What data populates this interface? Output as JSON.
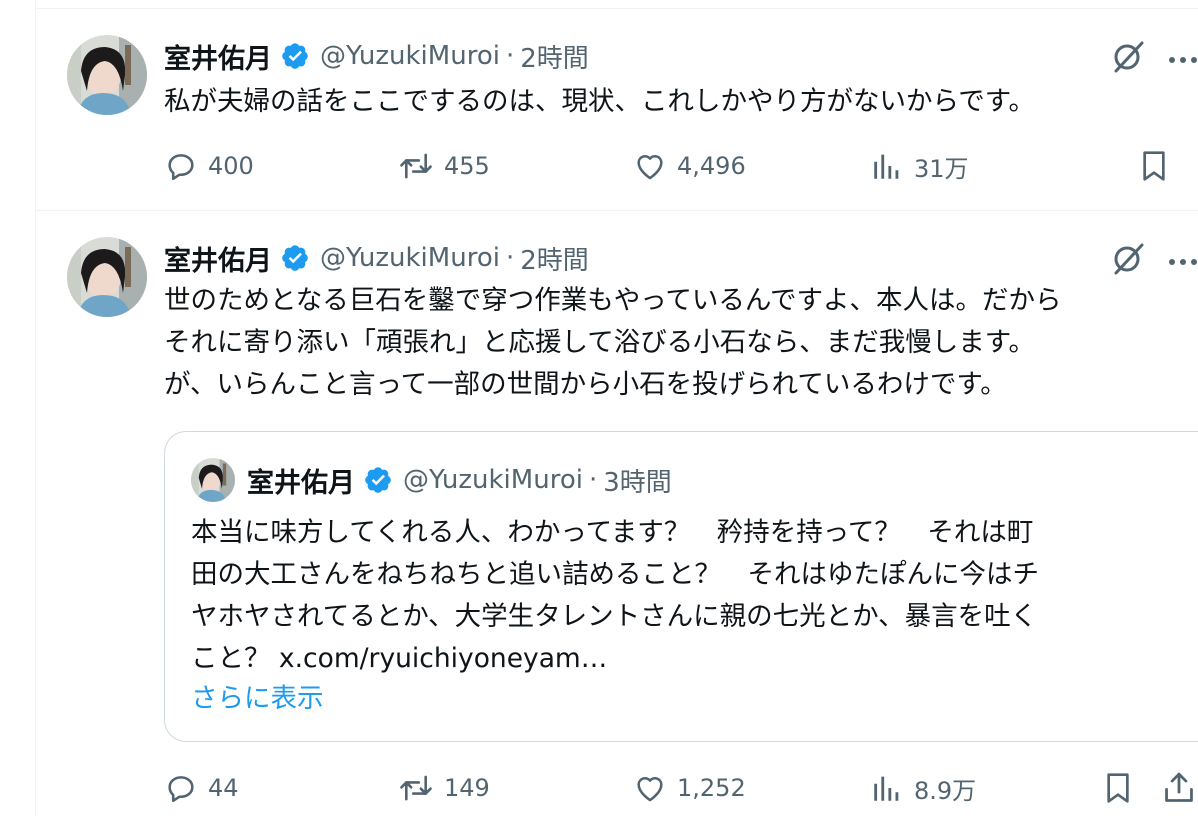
{
  "tweets": [
    {
      "author": {
        "name": "室井佑月",
        "handle": "@YuzukiMuroi",
        "verified": true
      },
      "separator": "·",
      "time": "2時間",
      "text_lines": [
        "私が夫婦の話をここでするのは、現状、これしかやり方がないからです。"
      ],
      "stats": {
        "replies": "400",
        "retweets": "455",
        "likes": "4,496",
        "views": "31万"
      }
    },
    {
      "author": {
        "name": "室井佑月",
        "handle": "@YuzukiMuroi",
        "verified": true
      },
      "separator": "·",
      "time": "2時間",
      "text_lines": [
        "世のためとなる巨石を鑿で穿つ作業もやっているんですよ、本人は。だから",
        "それに寄り添い「頑張れ」と応援して浴びる小石なら、まだ我慢します。",
        "が、いらんこと言って一部の世間から小石を投げられているわけです。"
      ],
      "quote": {
        "author": {
          "name": "室井佑月",
          "handle": "@YuzukiMuroi",
          "verified": true
        },
        "separator": "·",
        "time": "3時間",
        "text_lines": [
          "本当に味方してくれる人、わかってます？　矜持を持って？　それは町",
          "田の大工さんをねちねちと追い詰めること？　それはゆたぽんに今はチ",
          "ヤホヤされてるとか、大学生タレントさんに親の七光とか、暴言を吐く",
          "こと？ x.com/ryuichiyoneyam…"
        ],
        "show_more": "さらに表示"
      },
      "stats": {
        "replies": "44",
        "retweets": "149",
        "likes": "1,252",
        "views": "8.9万"
      }
    }
  ],
  "icons": {
    "reply": "speech-bubble-icon",
    "retweet": "retweet-arrows-icon",
    "like": "heart-icon",
    "views": "bar-chart-icon",
    "bookmark": "bookmark-icon",
    "share": "share-upload-icon",
    "grok": "grok-icon",
    "more": "more-dots-icon",
    "verified": "verified-badge-icon"
  },
  "colors": {
    "text": "#0f1419",
    "secondary": "#536471",
    "accent": "#1d9bf0",
    "border": "#cfd9de",
    "divider": "#eff3f4"
  }
}
